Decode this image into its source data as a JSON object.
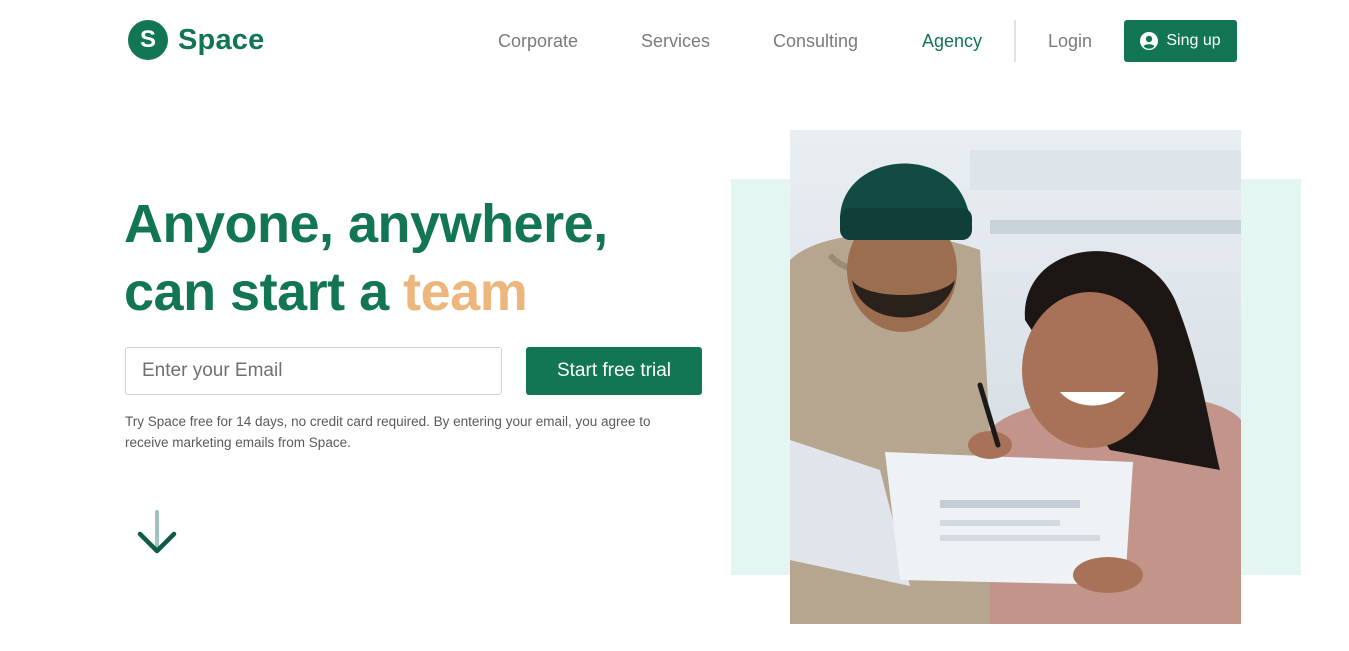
{
  "brand": {
    "logo_letter": "S",
    "name": "Space",
    "primary_color": "#127553",
    "accent_color": "#edb67c",
    "mint_color": "#e4f6f1"
  },
  "nav": {
    "items": [
      {
        "label": "Corporate",
        "active": false
      },
      {
        "label": "Services",
        "active": false
      },
      {
        "label": "Consulting",
        "active": false
      },
      {
        "label": "Agency",
        "active": true
      }
    ],
    "login_label": "Login",
    "signup_label": "Sing up",
    "signup_icon": "user-circle-icon"
  },
  "hero": {
    "headline_line1": "Anyone, anywhere,",
    "headline_line2_prefix": "can start a ",
    "headline_line2_accent": "team",
    "email_placeholder": "Enter your Email",
    "email_value": "",
    "cta_label": "Start free trial",
    "disclaimer": "Try Space free for 14 days, no credit card required. By entering your email, you agree to receive marketing emails from Space.",
    "scroll_icon": "arrow-down-icon"
  }
}
